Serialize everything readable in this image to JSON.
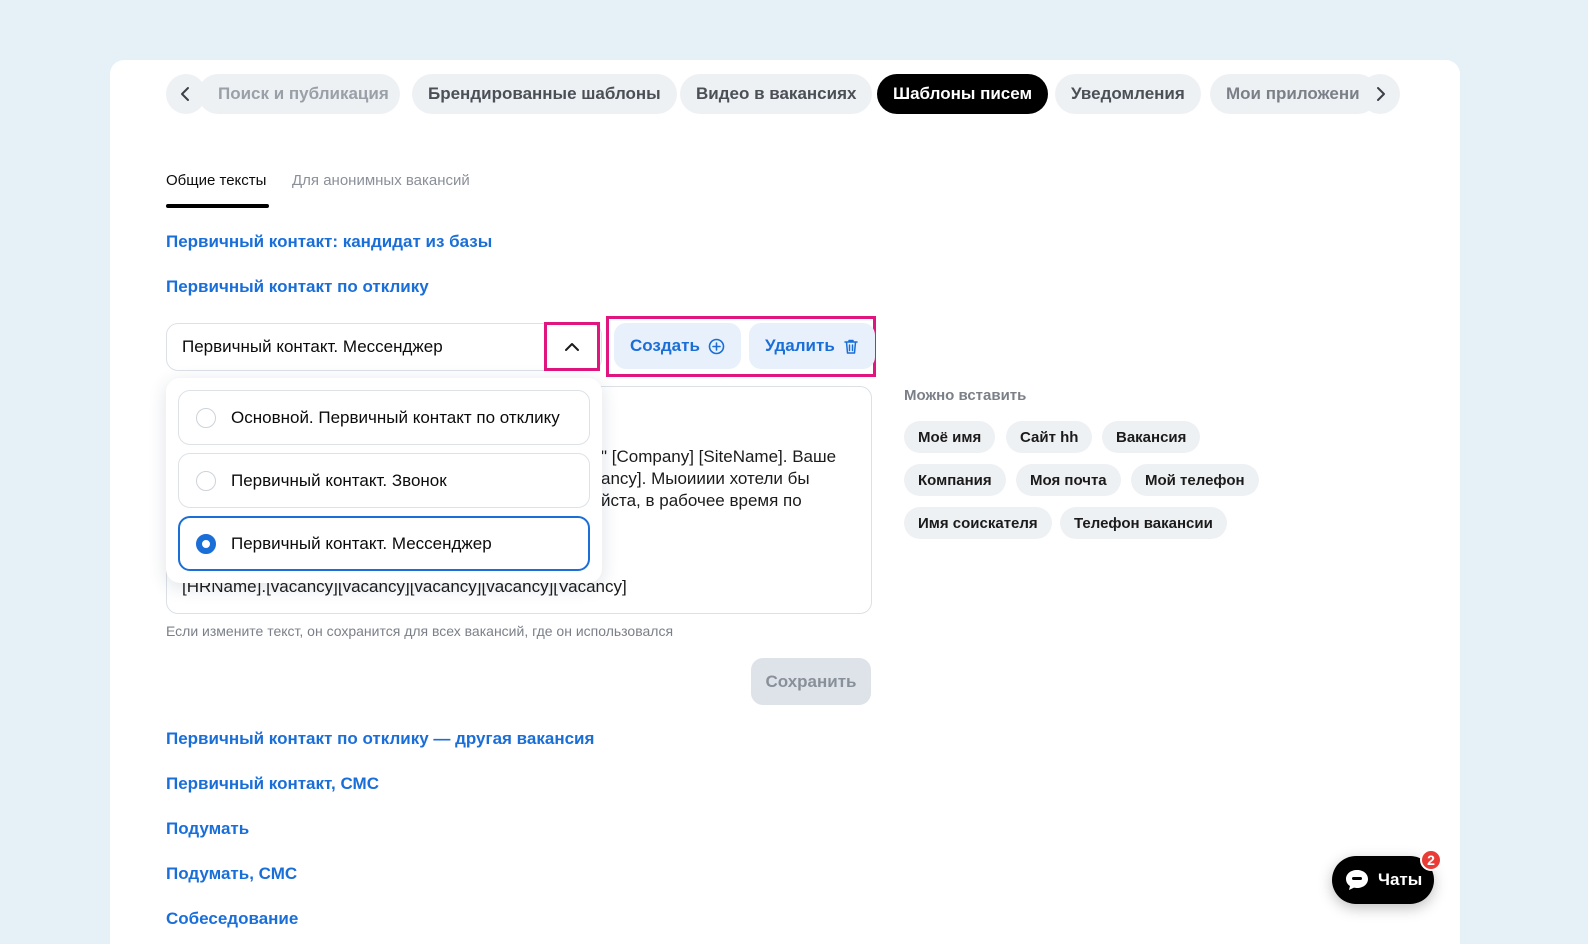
{
  "tabs": [
    {
      "label": "Поиск и публикация"
    },
    {
      "label": "Брендированные шаблоны"
    },
    {
      "label": "Видео в вакансиях"
    },
    {
      "label": "Шаблоны писем",
      "active": true
    },
    {
      "label": "Уведомления"
    },
    {
      "label": "Мои приложени"
    }
  ],
  "subtabs": {
    "general": "Общие тексты",
    "anonymous": "Для анонимных вакансий"
  },
  "sections_top": [
    "Первичный контакт: кандидат из базы",
    "Первичный контакт по отклику"
  ],
  "template_select": {
    "value": "Первичный контакт. Мессенджер"
  },
  "actions": {
    "create": "Создать",
    "delete": "Удалить"
  },
  "dropdown_options": [
    {
      "label": "Основной. Первичный контакт по отклику",
      "selected": false
    },
    {
      "label": "Первичный контакт. Звонок",
      "selected": false
    },
    {
      "label": "Первичный контакт. Мессенджер",
      "selected": true
    }
  ],
  "textarea_visible": {
    "line1": "\" [Company] [SiteName]. Ваше",
    "line2": "ancy]. Мыоииии хотели бы",
    "line3": "йста, в рабочее время по",
    "line_last": "[HRName].[vacancy][vacancy][vacancy][vacancy][Vacancy]"
  },
  "hint": "Если измените текст, он сохранится для всех вакансий, где он использовался",
  "save_label": "Сохранить",
  "insert_panel": {
    "title": "Можно вставить",
    "chips": [
      "Моё имя",
      "Сайт hh",
      "Вакансия",
      "Компания",
      "Моя почта",
      "Мой телефон",
      "Имя соискателя",
      "Телефон вакансии"
    ]
  },
  "sections_bottom": [
    "Первичный контакт по отклику — другая вакансия",
    "Первичный контакт, СМС",
    "Подумать",
    "Подумать, СМС",
    "Собеседование"
  ],
  "chat": {
    "label": "Чаты",
    "badge": "2"
  },
  "colors": {
    "accent": "#1a6ed8",
    "highlight": "#e0157f",
    "badge": "#ea3c37"
  }
}
